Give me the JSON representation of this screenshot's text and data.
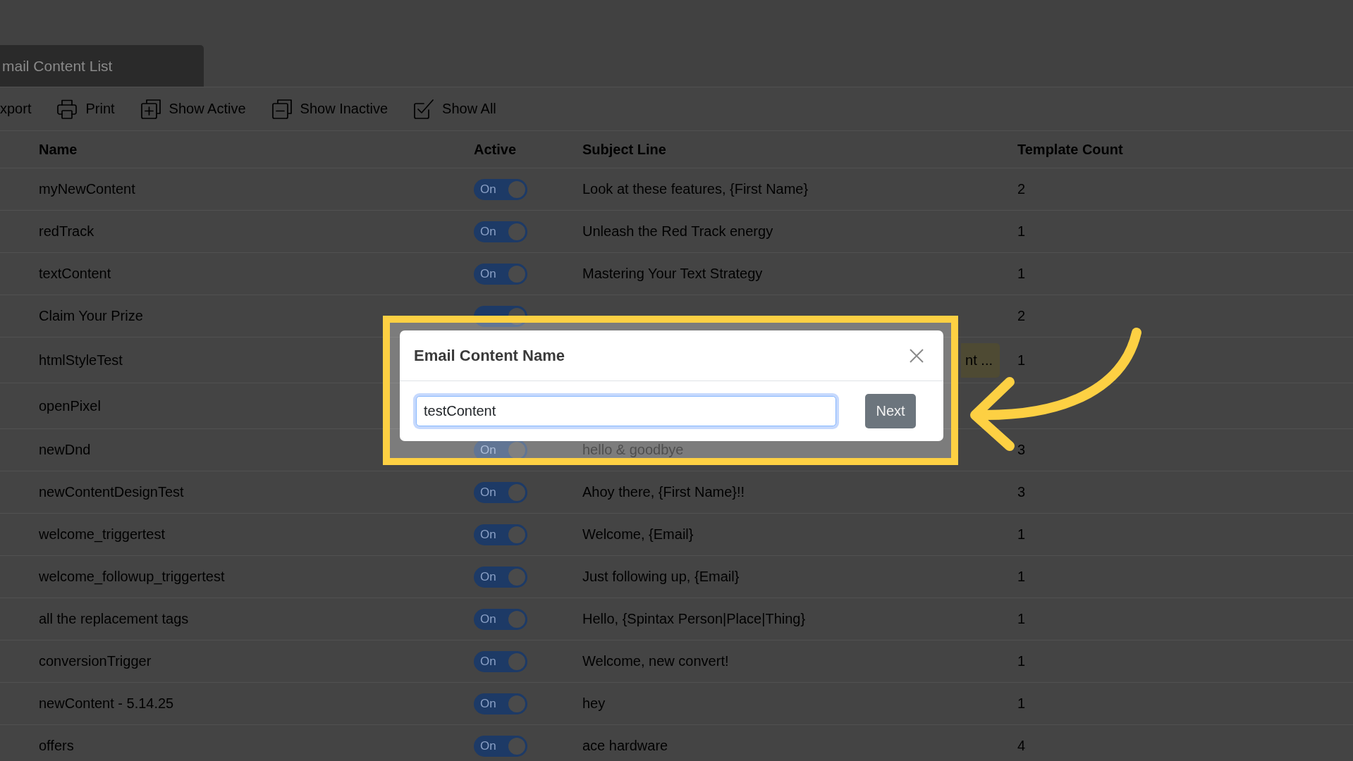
{
  "page_tab": {
    "title": "mail Content List"
  },
  "toolbar": [
    {
      "kind": "export",
      "label": "xport"
    },
    {
      "kind": "print",
      "label": "Print"
    },
    {
      "kind": "active",
      "label": "Show Active"
    },
    {
      "kind": "inactive",
      "label": "Show Inactive"
    },
    {
      "kind": "all",
      "label": "Show All"
    }
  ],
  "table": {
    "columns": [
      "Name",
      "Active",
      "Subject Line",
      "Template Count"
    ],
    "rows": [
      {
        "name": "myNewContent",
        "active": {
          "label": "On",
          "on": true
        },
        "subject": "Look at these features, {First Name}",
        "template_count": "2"
      },
      {
        "name": "redTrack",
        "active": {
          "label": "On",
          "on": true
        },
        "subject": "Unleash the Red Track energy",
        "template_count": "1"
      },
      {
        "name": "textContent",
        "active": {
          "label": "On",
          "on": true
        },
        "subject": "Mastering Your Text Strategy",
        "template_count": "1"
      },
      {
        "name": "Claim Your Prize",
        "active": {
          "on": true
        },
        "template_count": "2"
      },
      {
        "name": "htmlStyleTest",
        "tag": "nt ...",
        "template_count": "1"
      },
      {
        "name": "openPixel"
      },
      {
        "name": "newDnd",
        "active": {
          "label": "On",
          "on": true
        },
        "subject": "hello & goodbye",
        "template_count": "3"
      },
      {
        "name": "newContentDesignTest",
        "active": {
          "label": "On",
          "on": true
        },
        "subject": "Ahoy there, {First Name}!!",
        "template_count": "3"
      },
      {
        "name": "welcome_triggertest",
        "active": {
          "label": "On",
          "on": true
        },
        "subject": "Welcome, {Email}",
        "template_count": "1"
      },
      {
        "name": "welcome_followup_triggertest",
        "active": {
          "label": "On",
          "on": true
        },
        "subject": "Just following up, {Email}",
        "template_count": "1"
      },
      {
        "name": "all the replacement tags",
        "active": {
          "label": "On",
          "on": true
        },
        "subject": "Hello, {Spintax Person|Place|Thing}",
        "template_count": "1"
      },
      {
        "name": "conversionTrigger",
        "active": {
          "label": "On",
          "on": true
        },
        "subject": "Welcome, new convert!",
        "template_count": "1"
      },
      {
        "name": "newContent - 5.14.25",
        "active": {
          "label": "On",
          "on": true
        },
        "subject": "hey",
        "template_count": "1"
      },
      {
        "name": "offers",
        "active": {
          "label": "On",
          "on": true
        },
        "subject": "ace hardware",
        "template_count": "4"
      }
    ]
  },
  "modal": {
    "title": "Email Content Name",
    "input": {
      "value": "testContent",
      "focused": true
    },
    "next_button": "Next"
  }
}
